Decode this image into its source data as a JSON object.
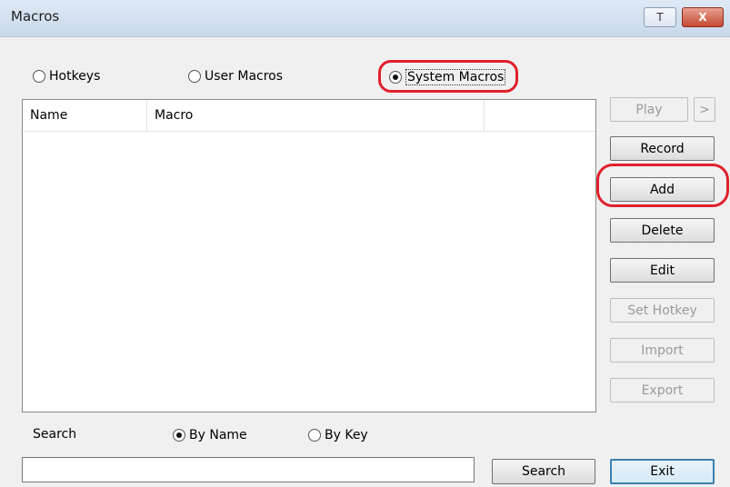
{
  "window": {
    "title": "Macros",
    "pin_button_label": "T",
    "close_button_label": "X"
  },
  "mode": {
    "options": [
      {
        "label": "Hotkeys",
        "selected": false
      },
      {
        "label": "User Macros",
        "selected": false
      },
      {
        "label": "System Macros",
        "selected": true
      }
    ]
  },
  "list": {
    "columns": [
      "Name",
      "Macro",
      ""
    ],
    "rows": []
  },
  "actions": {
    "play": {
      "label": "Play",
      "enabled": false
    },
    "play_more": {
      "label": ">",
      "enabled": false
    },
    "record": {
      "label": "Record",
      "enabled": true
    },
    "add": {
      "label": "Add",
      "enabled": true
    },
    "delete": {
      "label": "Delete",
      "enabled": true
    },
    "edit": {
      "label": "Edit",
      "enabled": true
    },
    "set_hotkey": {
      "label": "Set Hotkey",
      "enabled": false
    },
    "import": {
      "label": "Import",
      "enabled": false
    },
    "export": {
      "label": "Export",
      "enabled": false
    }
  },
  "search": {
    "label": "Search",
    "by_options": [
      {
        "label": "By Name",
        "selected": true
      },
      {
        "label": "By Key",
        "selected": false
      }
    ],
    "input_value": "",
    "search_button_label": "Search"
  },
  "footer": {
    "exit_button_label": "Exit"
  },
  "colors": {
    "highlight": "#e0202a",
    "titlebar": "#c9d8ea",
    "default_button_border": "#3c7fb1"
  }
}
